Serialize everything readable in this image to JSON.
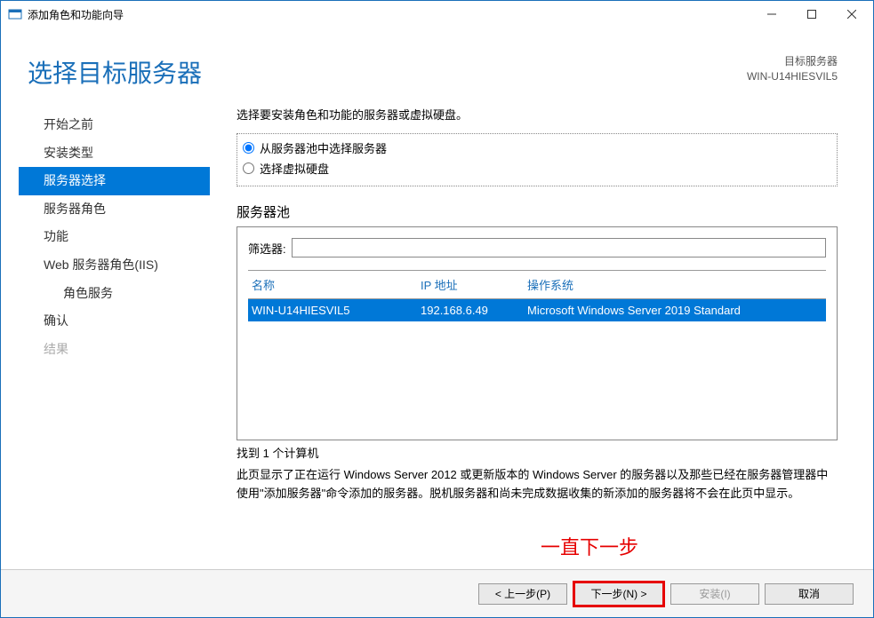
{
  "window": {
    "title": "添加角色和功能向导"
  },
  "header": {
    "page_title": "选择目标服务器",
    "dest_label": "目标服务器",
    "dest_server": "WIN-U14HIESVIL5"
  },
  "sidebar": {
    "items": [
      {
        "label": "开始之前"
      },
      {
        "label": "安装类型"
      },
      {
        "label": "服务器选择"
      },
      {
        "label": "服务器角色"
      },
      {
        "label": "功能"
      },
      {
        "label": "Web 服务器角色(IIS)"
      },
      {
        "label": "角色服务"
      },
      {
        "label": "确认"
      },
      {
        "label": "结果"
      }
    ]
  },
  "content": {
    "instruction": "选择要安装角色和功能的服务器或虚拟硬盘。",
    "radio_pool": "从服务器池中选择服务器",
    "radio_vhd": "选择虚拟硬盘",
    "pool_label": "服务器池",
    "filter_label": "筛选器:",
    "filter_value": "",
    "columns": {
      "name": "名称",
      "ip": "IP 地址",
      "os": "操作系统"
    },
    "rows": [
      {
        "name": "WIN-U14HIESVIL5",
        "ip": "192.168.6.49",
        "os": "Microsoft Windows Server 2019 Standard"
      }
    ],
    "found": "找到 1 个计算机",
    "note": "此页显示了正在运行 Windows Server 2012 或更新版本的 Windows Server 的服务器以及那些已经在服务器管理器中使用\"添加服务器\"命令添加的服务器。脱机服务器和尚未完成数据收集的新添加的服务器将不会在此页中显示。"
  },
  "annotation": "一直下一步",
  "footer": {
    "prev": "< 上一步(P)",
    "next": "下一步(N) >",
    "install": "安装(I)",
    "cancel": "取消"
  }
}
